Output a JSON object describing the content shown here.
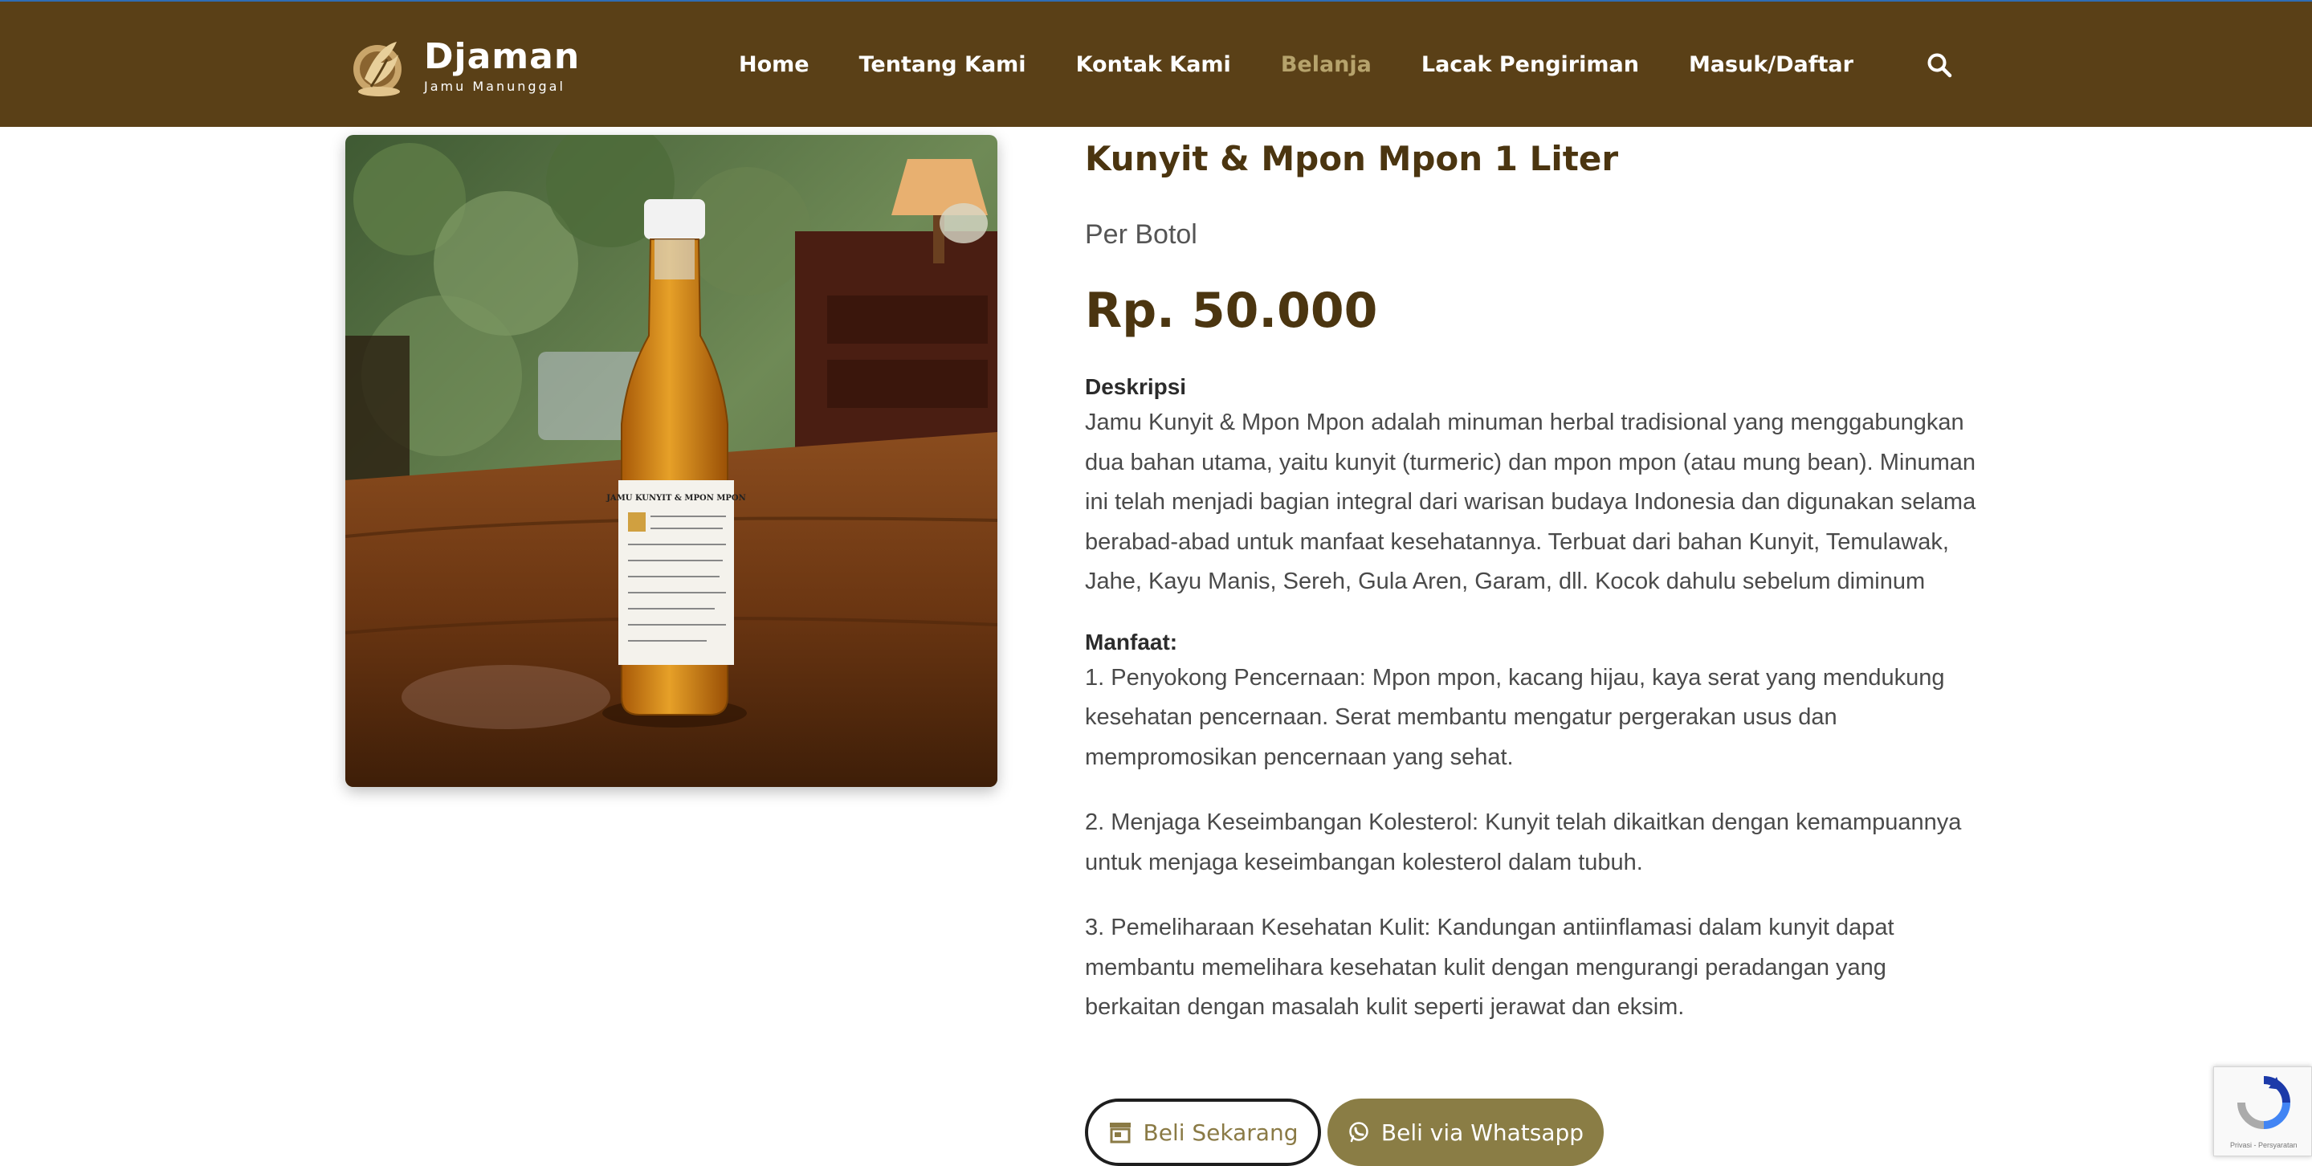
{
  "header": {
    "brand_name": "Djaman",
    "brand_tagline": "Jamu Manunggal",
    "nav": [
      {
        "label": "Home"
      },
      {
        "label": "Tentang Kami"
      },
      {
        "label": "Kontak Kami"
      },
      {
        "label": "Belanja",
        "active": true
      },
      {
        "label": "Lacak Pengiriman"
      },
      {
        "label": "Masuk/Daftar"
      }
    ],
    "search_icon": "search-icon",
    "colors": {
      "background": "#5a4017",
      "active_nav": "#b6a36c"
    }
  },
  "product": {
    "title": "Kunyit & Mpon Mpon 1 Liter",
    "unit": "Per Botol",
    "price": "Rp. 50.000",
    "image_label_text": "JAMU KUNYIT & MPON MPON",
    "description_heading": "Deskripsi",
    "description": "Jamu Kunyit & Mpon Mpon adalah minuman herbal tradisional yang menggabungkan dua bahan utama, yaitu kunyit (turmeric) dan mpon mpon (atau mung bean). Minuman ini telah menjadi bagian integral dari warisan budaya Indonesia dan digunakan selama berabad-abad untuk manfaat kesehatannya. Terbuat dari bahan Kunyit, Temulawak, Jahe, Kayu Manis, Sereh, Gula Aren, Garam, dll. Kocok dahulu sebelum diminum",
    "benefits_heading": "Manfaat:",
    "benefits": [
      "1. Penyokong Pencernaan: Mpon mpon, kacang hijau, kaya serat yang mendukung kesehatan pencernaan. Serat membantu mengatur pergerakan usus dan mempromosikan pencernaan yang sehat.",
      "2. Menjaga Keseimbangan Kolesterol: Kunyit telah dikaitkan dengan kemampuannya untuk menjaga keseimbangan kolesterol dalam tubuh.",
      "3. Pemeliharaan Kesehatan Kulit: Kandungan antiinflamasi dalam kunyit dapat membantu memelihara kesehatan kulit dengan mengurangi peradangan yang berkaitan dengan masalah kulit seperti jerawat dan eksim."
    ]
  },
  "actions": {
    "buy_now": "Beli Sekarang",
    "buy_now_icon": "store-icon",
    "buy_whatsapp": "Beli via Whatsapp",
    "buy_whatsapp_icon": "whatsapp-icon",
    "accent": "#8a7d45"
  },
  "recaptcha": {
    "footer_text": "Privasi - Persyaratan"
  }
}
